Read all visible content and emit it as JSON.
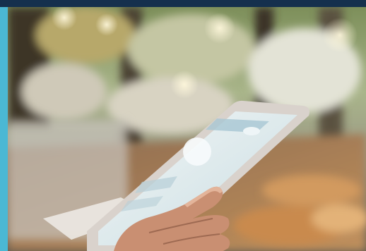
{
  "frame": {
    "top_bar_color": "#15304d",
    "stripe_color": "#4bb8d4"
  },
  "photo": {
    "subject": "hand-holding-tablet",
    "palette": {
      "skin": "#c98f72",
      "skin_shadow": "#9e6a52",
      "tablet_body": "#d9d2cc",
      "screen": "#e7f0f2",
      "screen_accent": "#a7c7d3",
      "wood": "#b98555",
      "bokeh_green": "#9bb075"
    }
  }
}
